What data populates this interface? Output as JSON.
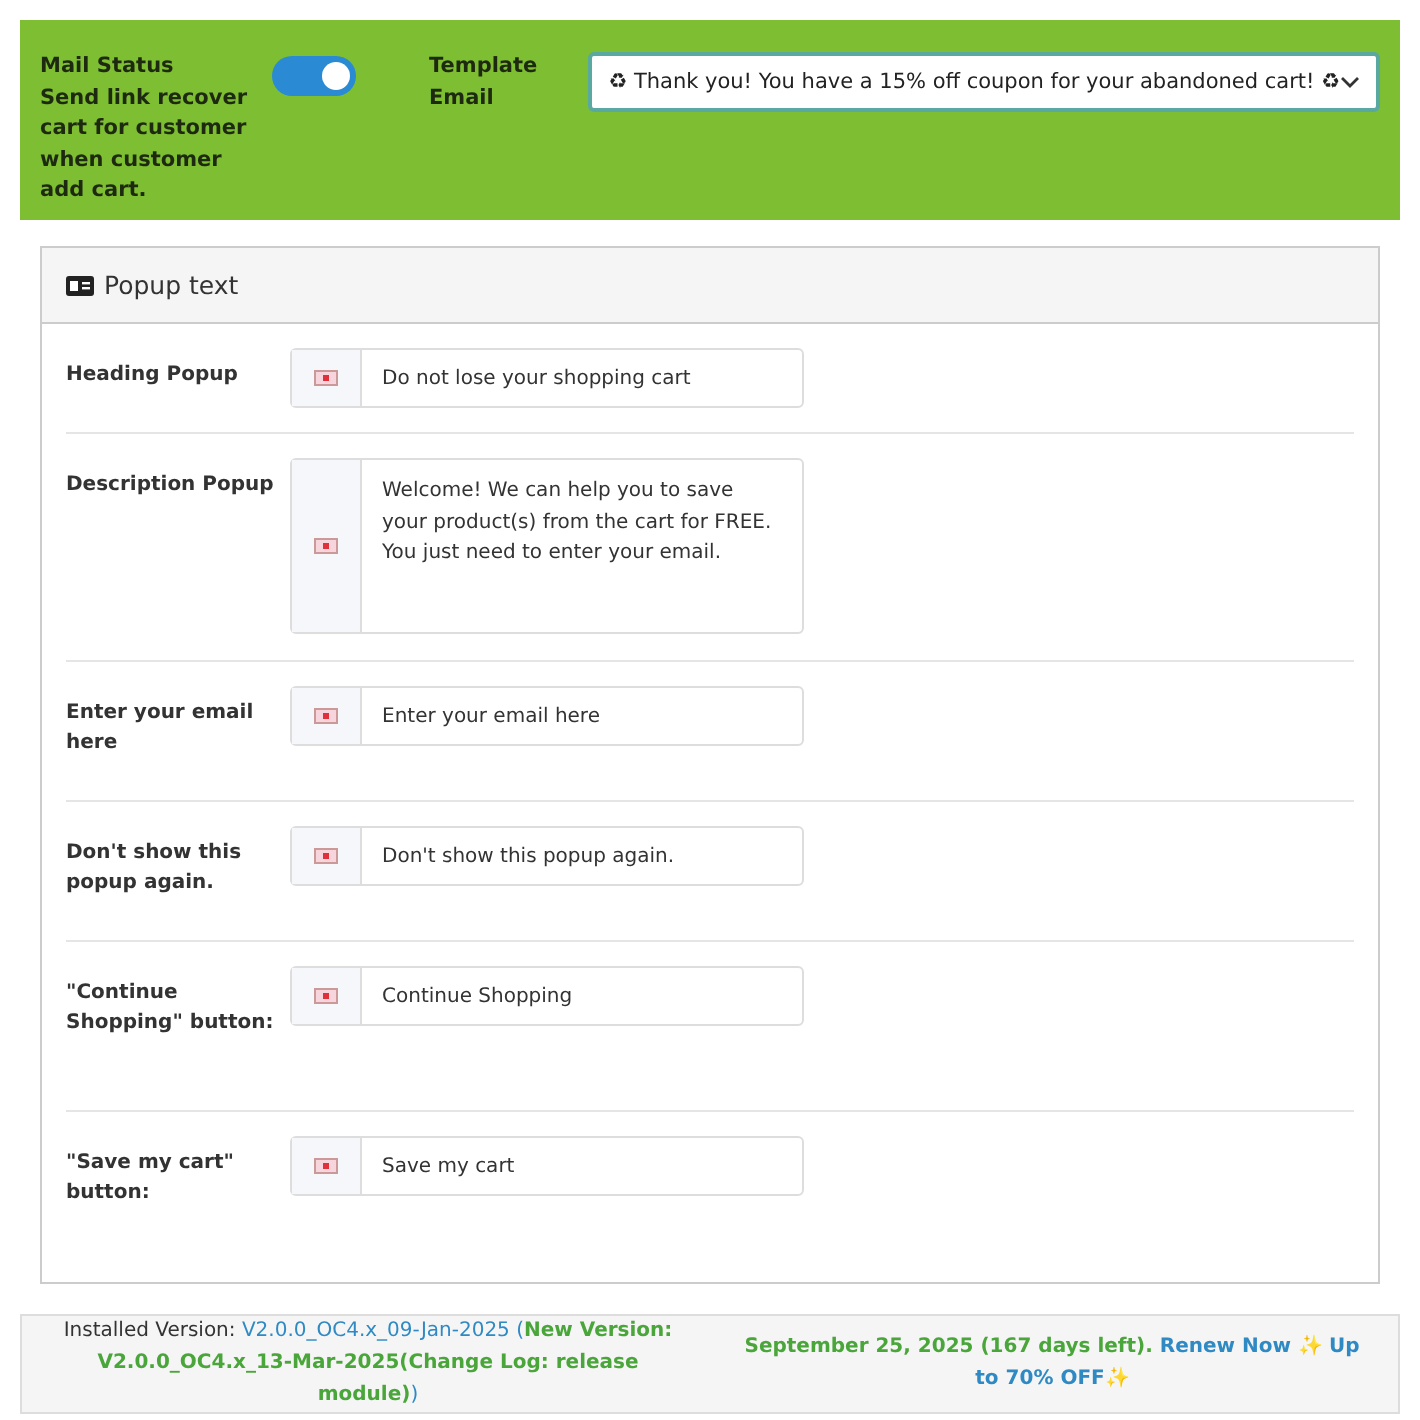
{
  "settings_bar": {
    "mail_status": {
      "label": "Mail Status",
      "description": "Send link recover cart for customer when customer add cart.",
      "on": true
    },
    "template_email": {
      "label": "Template Email",
      "value": "♻ Thank you! You have a 15% off coupon for your abandoned cart! ♻"
    }
  },
  "panel": {
    "title": "Popup text",
    "fields": [
      {
        "label": "Heading Popup",
        "kind": "input",
        "value": "Do not lose your shopping cart"
      },
      {
        "label": "Description Popup",
        "kind": "textarea",
        "value": "Welcome! We can help you to save your product(s) from the cart for FREE. You just need to enter your email."
      },
      {
        "label": "Enter your email here",
        "kind": "input",
        "value": "Enter your email here"
      },
      {
        "label": "Don't show this popup again.",
        "kind": "input",
        "value": "Don't show this popup again."
      },
      {
        "label": "\"Continue Shopping\" button:",
        "kind": "input",
        "value": "Continue Shopping"
      },
      {
        "label": "\"Save my cart\" button:",
        "kind": "input",
        "value": "Save my cart"
      }
    ]
  },
  "footer": {
    "version_parts": [
      {
        "text": "Installed Version: ",
        "kind": "plain"
      },
      {
        "text": "V2.0.0_OC4.x_09-Jan-2025 (",
        "kind": "blue"
      },
      {
        "text": "New Version: V2.0.0_OC4.x_13-Mar-2025(Change Log: release module)",
        "kind": "green"
      },
      {
        "text": ")",
        "kind": "blue"
      }
    ],
    "license_parts": [
      {
        "text": "September 25, 2025 (167 days left). ",
        "kind": "green"
      },
      {
        "text": "Renew Now ✨ Up to 70% OFF✨",
        "kind": "blue"
      }
    ]
  }
}
